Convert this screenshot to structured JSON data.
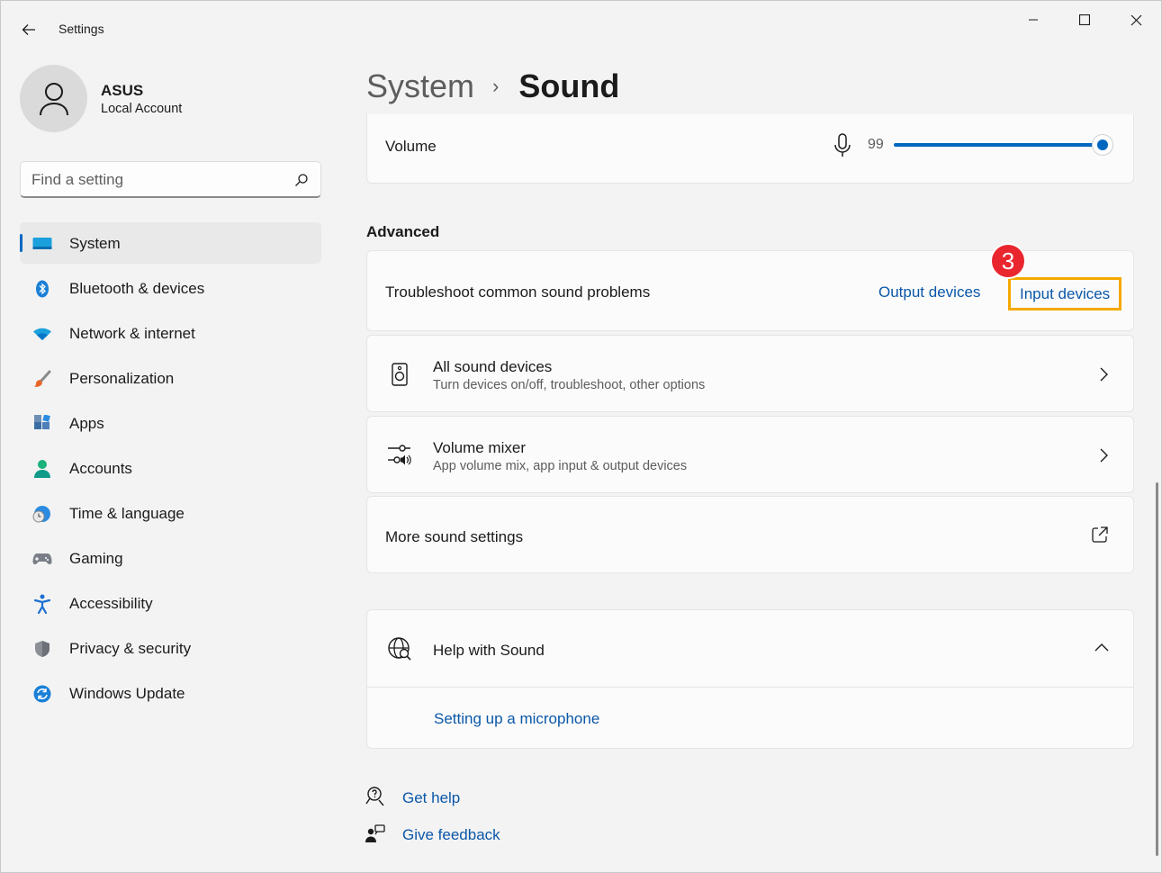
{
  "window": {
    "title": "Settings",
    "controls": [
      "minimize",
      "maximize",
      "close"
    ]
  },
  "user": {
    "name": "ASUS",
    "account_type": "Local Account"
  },
  "search": {
    "placeholder": "Find a setting"
  },
  "sidebar": {
    "items": [
      {
        "label": "System",
        "icon": "system-icon",
        "active": true
      },
      {
        "label": "Bluetooth & devices",
        "icon": "bluetooth-icon"
      },
      {
        "label": "Network & internet",
        "icon": "wifi-icon"
      },
      {
        "label": "Personalization",
        "icon": "brush-icon"
      },
      {
        "label": "Apps",
        "icon": "apps-icon"
      },
      {
        "label": "Accounts",
        "icon": "person-icon"
      },
      {
        "label": "Time & language",
        "icon": "globe-clock-icon"
      },
      {
        "label": "Gaming",
        "icon": "gamepad-icon"
      },
      {
        "label": "Accessibility",
        "icon": "accessibility-icon"
      },
      {
        "label": "Privacy & security",
        "icon": "shield-icon"
      },
      {
        "label": "Windows Update",
        "icon": "update-icon"
      }
    ]
  },
  "header": {
    "breadcrumb_parent": "System",
    "breadcrumb_separator": "›",
    "breadcrumb_current": "Sound"
  },
  "volume": {
    "label": "Volume",
    "value": "99",
    "level_percent": 99,
    "icon": "microphone-icon"
  },
  "advanced": {
    "heading": "Advanced",
    "troubleshoot": {
      "label": "Troubleshoot common sound problems",
      "output_link": "Output devices",
      "input_link": "Input devices",
      "step_badge": "3"
    },
    "all_devices": {
      "title": "All sound devices",
      "subtitle": "Turn devices on/off, troubleshoot, other options",
      "icon": "speaker-icon"
    },
    "mixer": {
      "title": "Volume mixer",
      "subtitle": "App volume mix, app input & output devices",
      "icon": "mixer-icon"
    },
    "more": {
      "title": "More sound settings",
      "icon": "open-external-icon"
    }
  },
  "help": {
    "title": "Help with Sound",
    "icon": "globe-search-icon",
    "link": "Setting up a microphone"
  },
  "footer": {
    "get_help": "Get help",
    "give_feedback": "Give feedback"
  },
  "colors": {
    "accent": "#0067c0",
    "link": "#0b57a8",
    "highlight_box": "#f5a800",
    "badge": "#e9262e"
  }
}
